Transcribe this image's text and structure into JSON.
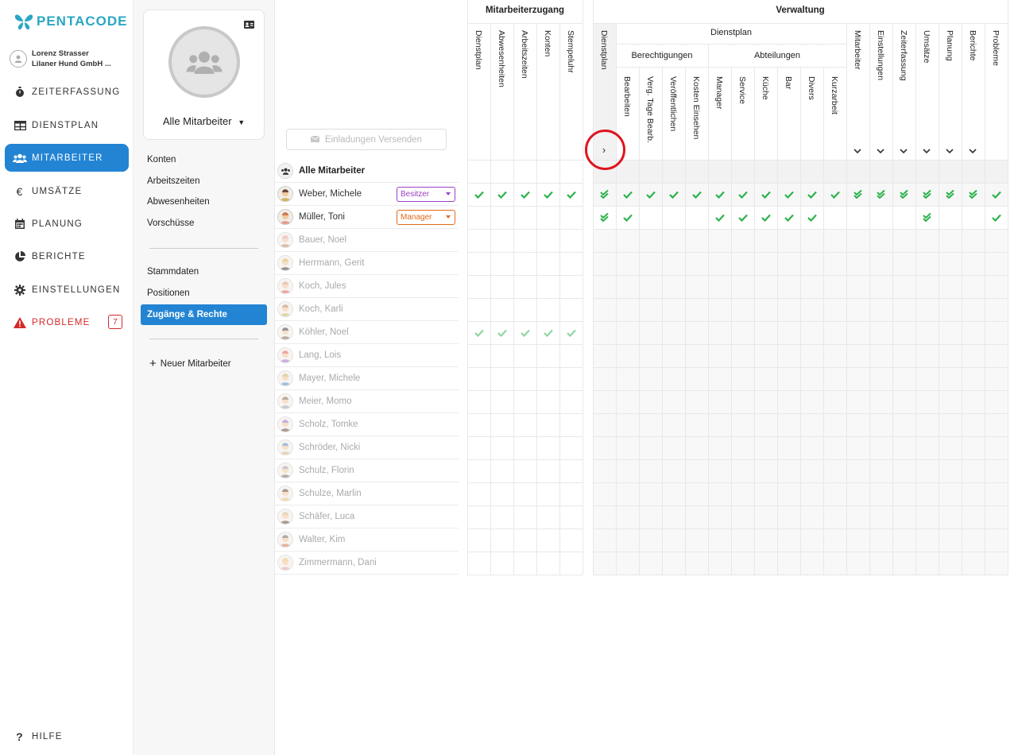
{
  "brand": {
    "name": "PENTACODE",
    "color": "#2aa7c4"
  },
  "user": {
    "name": "Lorenz Strasser",
    "company": "Lilaner Hund GmbH ..."
  },
  "nav": {
    "items": [
      {
        "label": "ZEITERFASSUNG",
        "icon": "stopwatch-icon"
      },
      {
        "label": "DIENSTPLAN",
        "icon": "table-icon"
      },
      {
        "label": "MITARBEITER",
        "icon": "users-icon",
        "active": true
      },
      {
        "label": "UMSÄTZE",
        "icon": "euro-icon"
      },
      {
        "label": "PLANUNG",
        "icon": "calendar-icon"
      },
      {
        "label": "BERICHTE",
        "icon": "pie-chart-icon"
      },
      {
        "label": "EINSTELLUNGEN",
        "icon": "gear-icon"
      },
      {
        "label": "PROBLEME",
        "icon": "warning-icon",
        "badge": "7"
      }
    ],
    "help": "HILFE",
    "accent": "#2384d3",
    "danger": "#d62828"
  },
  "sub": {
    "group_select": "Alle Mitarbeiter",
    "links1": [
      "Konten",
      "Arbeitszeiten",
      "Abwesenheiten",
      "Vorschüsse"
    ],
    "links2": [
      "Stammdaten",
      "Positionen"
    ],
    "active": "Zugänge & Rechte",
    "new_employee": "Neuer Mitarbeiter"
  },
  "main": {
    "invite_button": "Einladungen Versenden",
    "all_label": "Alle Mitarbeiter",
    "employees": [
      {
        "name": "Weber, Michele",
        "role": "Besitzer",
        "role_color": "#9b3fc4",
        "active": true
      },
      {
        "name": "Müller, Toni",
        "role": "Manager",
        "role_color": "#e06a1a",
        "active": true
      },
      {
        "name": "Bauer, Noel"
      },
      {
        "name": "Herrmann, Gerit"
      },
      {
        "name": "Koch, Jules"
      },
      {
        "name": "Koch, Karli"
      },
      {
        "name": "Köhler, Noel"
      },
      {
        "name": "Lang, Lois"
      },
      {
        "name": "Mayer, Michele"
      },
      {
        "name": "Meier, Momo"
      },
      {
        "name": "Scholz, Tomke"
      },
      {
        "name": "Schröder, Nicki"
      },
      {
        "name": "Schulz, Florin"
      },
      {
        "name": "Schulze, Marlin"
      },
      {
        "name": "Schäfer, Luca"
      },
      {
        "name": "Walter, Kim"
      },
      {
        "name": "Zimmermann, Dani"
      }
    ]
  },
  "grid1": {
    "title": "Mitarbeiterzugang",
    "columns": [
      "Dienstplan",
      "Abwesenheiten",
      "Arbeitszeiten",
      "Konten",
      "Stempeluhr"
    ],
    "rows": [
      [
        "check",
        "check",
        "check",
        "check",
        "check"
      ],
      [
        "",
        "",
        "",
        "",
        ""
      ],
      [
        "",
        "",
        "",
        "",
        ""
      ],
      [
        "",
        "",
        "",
        "",
        ""
      ],
      [
        "",
        "",
        "",
        "",
        ""
      ],
      [
        "",
        "",
        "",
        "",
        ""
      ],
      [
        "check-light",
        "check-light",
        "check-light",
        "check-light",
        "check-light"
      ]
    ]
  },
  "grid2": {
    "title": "Verwaltung",
    "group_dienstplan": "Dienstplan",
    "group_berechtigungen": "Berechtigungen",
    "group_abteilungen": "Abteilungen",
    "columns": [
      "Dienstplan",
      "Bearbeiten",
      "Verg. Tage Bearb.",
      "Veröffentlichen",
      "Kosten Einsehen",
      "Manager",
      "Service",
      "Küche",
      "Bar",
      "Divers",
      "Kurzarbeit",
      "Mitarbeiter",
      "Einstellungen",
      "Zeiterfassung",
      "Umsätze",
      "Planung",
      "Berichte",
      "Probleme"
    ],
    "expand_label": "›",
    "rows": [
      [
        "dbl",
        "check",
        "check",
        "check",
        "check",
        "check",
        "check",
        "check",
        "check",
        "check",
        "check",
        "dbl",
        "dbl",
        "dbl",
        "dbl",
        "dbl",
        "dbl",
        "check"
      ],
      [
        "dbl",
        "check",
        "",
        "",
        "",
        "check",
        "check",
        "check",
        "check",
        "check",
        "",
        "",
        "",
        "",
        "dbl",
        "",
        "",
        "check"
      ]
    ],
    "check_color": "#2bb24c"
  }
}
